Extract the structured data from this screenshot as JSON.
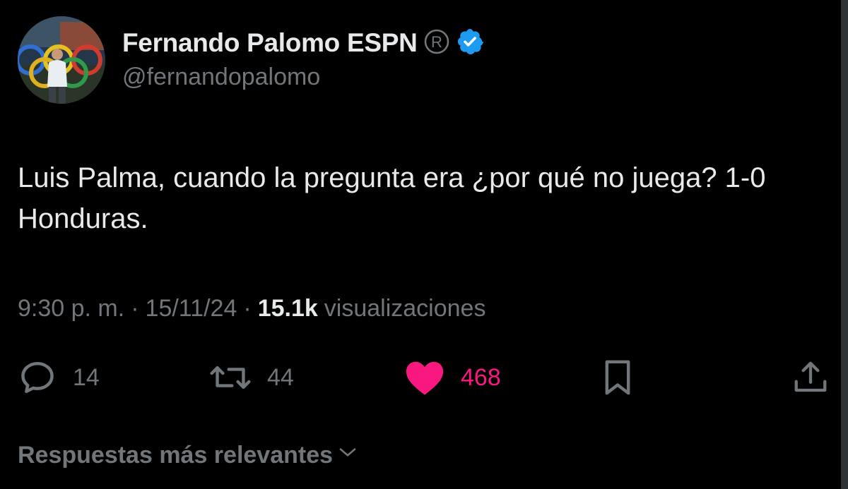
{
  "author": {
    "display_name": "Fernando Palomo ESPN",
    "registered_mark": "®",
    "handle": "@fernandopalomo"
  },
  "tweet": {
    "text": "Luis Palma, cuando la pregunta era ¿por qué no juega? 1-0 Honduras.",
    "time": "9:30 p. m.",
    "separator": "·",
    "date": "15/11/24",
    "views_count": "15.1k",
    "views_label": "visualizaciones"
  },
  "actions": {
    "replies": "14",
    "reposts": "44",
    "likes": "468"
  },
  "replies_sort": {
    "label": "Respuestas más relevantes"
  },
  "colors": {
    "background": "#000000",
    "primary_text": "#e7e9ea",
    "secondary_text": "#71767b",
    "verified_badge": "#1d9bf0",
    "like_active": "#f91880"
  },
  "icons": {
    "verified": "verified-badge-icon",
    "reply": "reply-bubble-icon",
    "repost": "repost-arrows-icon",
    "like": "heart-filled-icon",
    "bookmark": "bookmark-icon",
    "share": "share-upload-icon",
    "sort": "chevron-down-icon"
  }
}
